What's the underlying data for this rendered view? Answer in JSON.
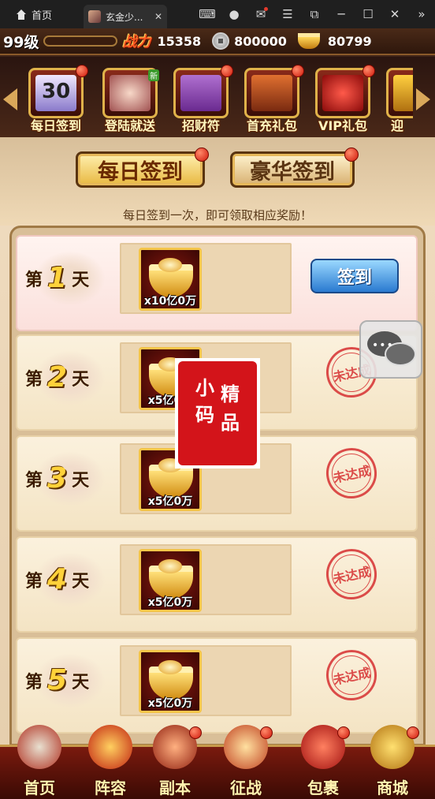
{
  "browser": {
    "home_tab": "首页",
    "game_tab": "玄金少...",
    "close": "✕",
    "toolbar_icons": [
      "gamepad-icon",
      "user-icon",
      "mail-icon",
      "menu-icon",
      "popout-icon",
      "minimize-icon",
      "maximize-icon",
      "close-icon",
      "collapse-icon"
    ]
  },
  "status": {
    "level": "99级",
    "power_label": "战力",
    "power_value": "15358",
    "silver": "800000",
    "gold": "80799"
  },
  "events": [
    {
      "label": "每日签到",
      "badge": true
    },
    {
      "label": "登陆就送",
      "badge": false,
      "new": "新"
    },
    {
      "label": "招财符",
      "badge": true
    },
    {
      "label": "首充礼包",
      "badge": true
    },
    {
      "label": "VIP礼包",
      "badge": true
    },
    {
      "label": "迎",
      "badge": false
    }
  ],
  "calendar_day": "30",
  "tabs": {
    "daily": "每日签到",
    "luxury": "豪华签到"
  },
  "subtitle": "每日签到一次，即可领取相应奖励！",
  "days": [
    {
      "prefix": "第",
      "num": "1",
      "suffix": "天",
      "qty": "x10亿0万",
      "state": "button",
      "action": "签到"
    },
    {
      "prefix": "第",
      "num": "2",
      "suffix": "天",
      "qty": "x5亿0万",
      "state": "stamp",
      "action": "未达成"
    },
    {
      "prefix": "第",
      "num": "3",
      "suffix": "天",
      "qty": "x5亿0万",
      "state": "stamp",
      "action": "未达成"
    },
    {
      "prefix": "第",
      "num": "4",
      "suffix": "天",
      "qty": "x5亿0万",
      "state": "stamp",
      "action": "未达成"
    },
    {
      "prefix": "第",
      "num": "5",
      "suffix": "天",
      "qty": "x5亿0万",
      "state": "stamp",
      "action": "未达成"
    }
  ],
  "seal": {
    "c1": "小",
    "c2": "精",
    "c3": "码",
    "c4": "品"
  },
  "nav": [
    {
      "label": "首页",
      "badge": false
    },
    {
      "label": "阵容",
      "badge": false
    },
    {
      "label": "副本",
      "badge": true
    },
    {
      "label": "征战",
      "badge": true
    },
    {
      "label": "包裹",
      "badge": true
    },
    {
      "label": "商城",
      "badge": true
    }
  ]
}
